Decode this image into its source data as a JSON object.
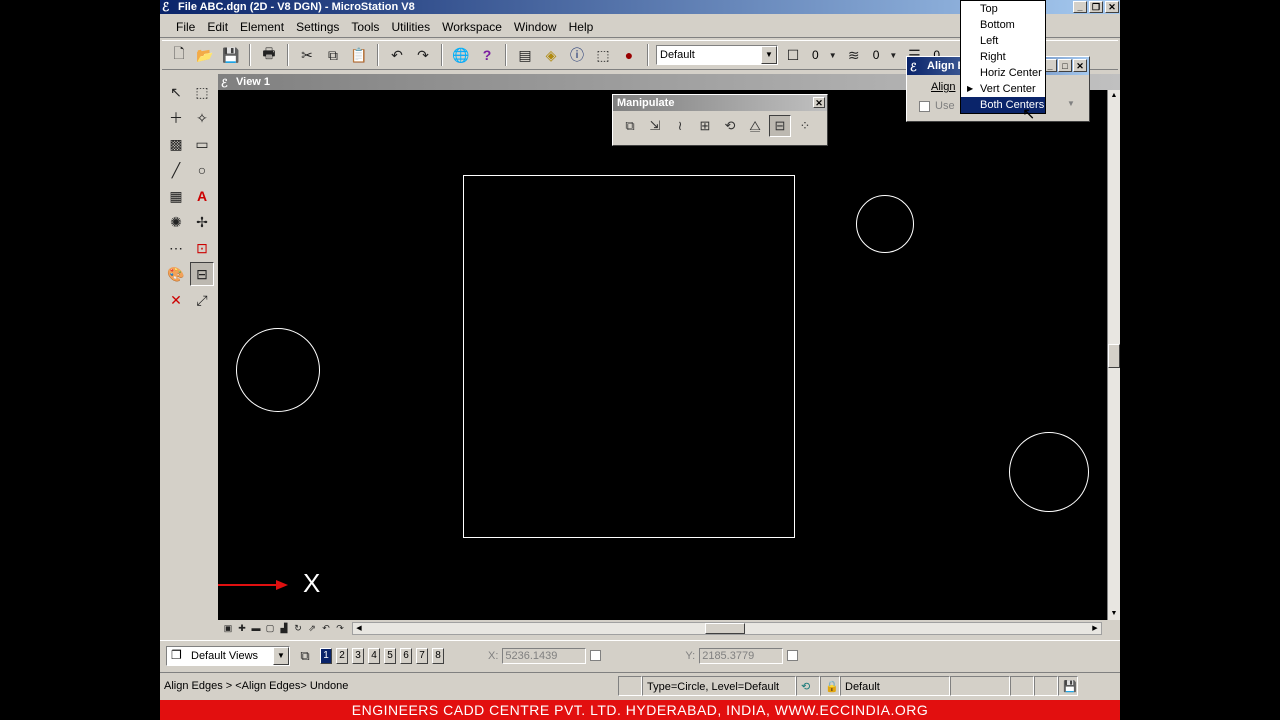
{
  "window": {
    "title": "File ABC.dgn (2D - V8 DGN) - MicroStation V8",
    "minimize": "_",
    "restore": "❐",
    "close": "✕"
  },
  "menu": [
    "File",
    "Edit",
    "Element",
    "Settings",
    "Tools",
    "Utilities",
    "Workspace",
    "Window",
    "Help"
  ],
  "toolbar": {
    "level_value": "Default",
    "color_value": "0",
    "weight_value": "0",
    "style_value": "0"
  },
  "view": {
    "title": "View 1",
    "axis_label": "X"
  },
  "manipulate": {
    "title": "Manipulate",
    "close": "✕"
  },
  "align_dialog": {
    "title": "Align E",
    "align_label": "Align",
    "use_label": "Use"
  },
  "dropdown": {
    "items": [
      "Top",
      "Bottom",
      "Left",
      "Right",
      "Horiz Center",
      "Vert Center",
      "Both Centers"
    ],
    "checked_index": 5,
    "selected_index": 6
  },
  "viewbar": {
    "views_value": "Default Views",
    "view_numbers": [
      "1",
      "2",
      "3",
      "4",
      "5",
      "6",
      "7",
      "8"
    ],
    "x_label": "X:",
    "x_value": "5236.1439",
    "y_label": "Y:",
    "y_value": "2185.3779"
  },
  "status": {
    "message": "Align Edges > <Align Edges> Undone",
    "element_info": "Type=Circle, Level=Default",
    "level": "Default"
  },
  "banner": "ENGINEERS CADD CENTRE PVT. LTD. HYDERABAD, INDIA, WWW.ECCINDIA.ORG",
  "colors": {
    "titlebar": "#0a246a",
    "canvas": "#000000",
    "banner": "#e20f0f",
    "axis_arrow": "#e01010"
  }
}
